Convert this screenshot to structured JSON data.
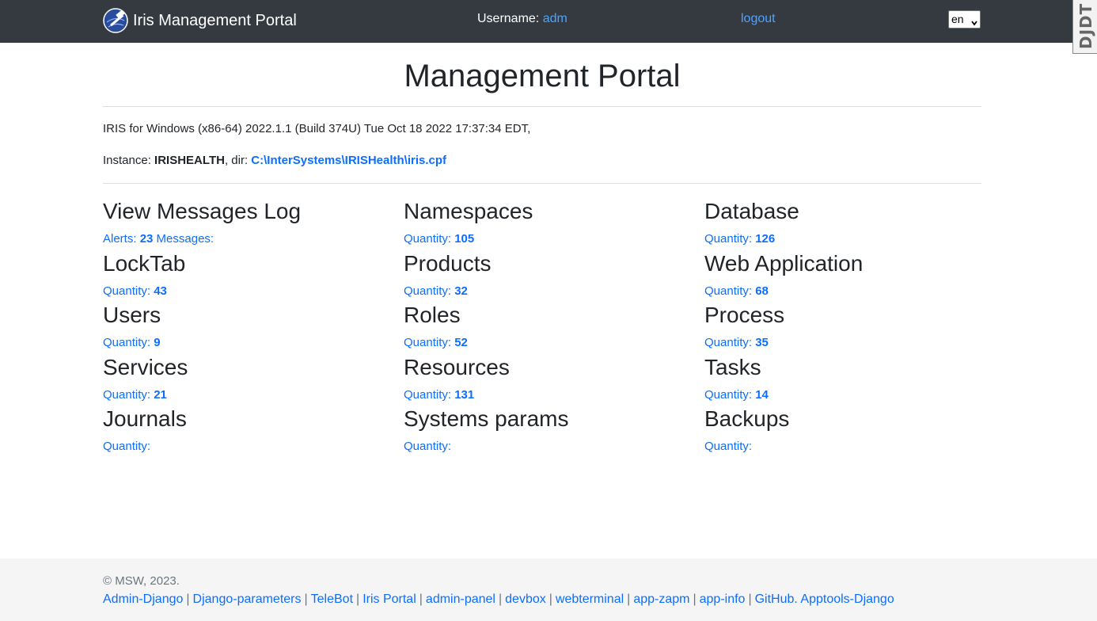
{
  "navbar": {
    "brand": "Iris Management Portal",
    "username_label": "Username:",
    "username": "adm",
    "logout": "logout",
    "language": "en",
    "debug_toolbar": "DJDT"
  },
  "header": {
    "title": "Management Portal",
    "system_info": "IRIS for Windows (x86-64) 2022.1.1 (Build 374U) Tue Oct 18 2022 17:37:34 EDT,",
    "instance_label": "Instance:",
    "instance_name": "IRISHEALTH",
    "dir_label": ", dir:",
    "dir_path": "C:\\InterSystems\\IRISHealth\\iris.cpf"
  },
  "sections": [
    [
      {
        "title": "View Messages Log",
        "alerts_label": "Alerts:",
        "alerts_value": "23",
        "messages_label": "Messages:"
      },
      {
        "title": "LockTab",
        "label": "Quantity:",
        "value": "43"
      },
      {
        "title": "Users",
        "label": "Quantity:",
        "value": "9"
      },
      {
        "title": "Services",
        "label": "Quantity:",
        "value": "21"
      },
      {
        "title": "Journals",
        "label": "Quantity:",
        "value": ""
      }
    ],
    [
      {
        "title": "Namespaces",
        "label": "Quantity:",
        "value": "105"
      },
      {
        "title": "Products",
        "label": "Quantity:",
        "value": "32"
      },
      {
        "title": "Roles",
        "label": "Quantity:",
        "value": "52"
      },
      {
        "title": "Resources",
        "label": "Quantity:",
        "value": "131"
      },
      {
        "title": "Systems params",
        "label": "Quantity:",
        "value": ""
      }
    ],
    [
      {
        "title": "Database",
        "label": "Quantity:",
        "value": "126"
      },
      {
        "title": "Web Application",
        "label": "Quantity:",
        "value": "68"
      },
      {
        "title": "Process",
        "label": "Quantity:",
        "value": "35"
      },
      {
        "title": "Tasks",
        "label": "Quantity:",
        "value": "14"
      },
      {
        "title": "Backups",
        "label": "Quantity:",
        "value": ""
      }
    ]
  ],
  "footer": {
    "copyright": "© MSW, 2023.",
    "separator": "|",
    "links": [
      "Admin-Django",
      "Django-parameters",
      "TeleBot",
      "Iris Portal",
      "admin-panel",
      "devbox",
      "webterminal",
      "app-zapm",
      "app-info",
      "GitHub. Apptools-Django"
    ]
  },
  "colors": {
    "navbar": "#343a40",
    "link": "#0d6efd",
    "footer_bg": "#f5f5f5"
  },
  "icons": {
    "brand_logo": "hammer-globe-icon",
    "language_select": "chevron-down-icon"
  }
}
